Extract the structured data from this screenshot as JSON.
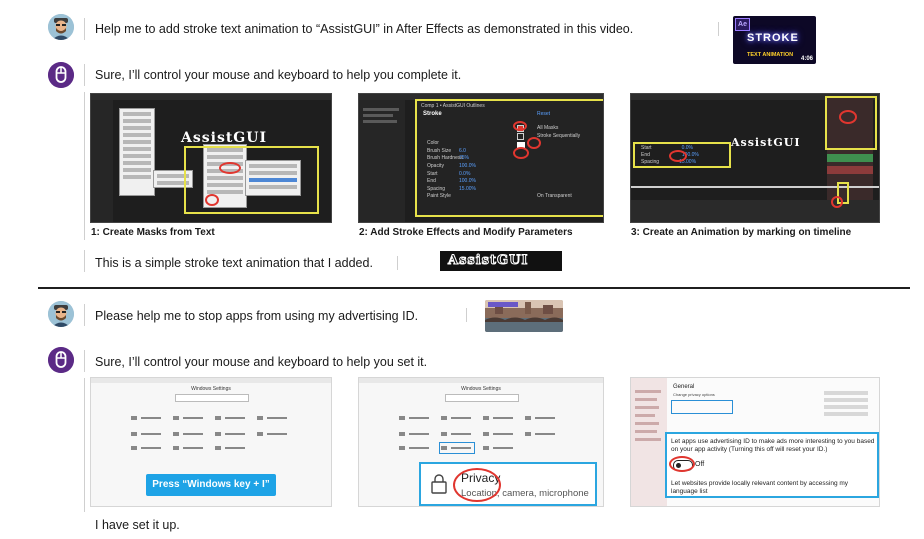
{
  "conversation1": {
    "user_message": "Help me to add stroke text animation to “AssistGUI” in After Effects as demonstrated in this video.",
    "video_thumb": {
      "badge": "Ae",
      "title": "STROKE",
      "subtitle": "TEXT ANIMATION",
      "duration": "4:06"
    },
    "bot_reply": "Sure, I’ll control your mouse and keyboard to help you complete it.",
    "steps": [
      {
        "caption": "1: Create Masks from Text",
        "shot_text": "AssistGUI"
      },
      {
        "caption": "2: Add Stroke Effects and Modify Parameters",
        "shot_text": "Comp 1 • AssistGUI Outlines",
        "panel_title": "Stroke",
        "panel_reset": "Reset",
        "rows": [
          "All Masks",
          "Stroke Sequentially",
          "Color",
          "Brush Size",
          "Brush Hardness",
          "Opacity",
          "Start",
          "End",
          "Spacing",
          "Paint Style"
        ],
        "values": [
          "",
          "",
          "",
          "6.0",
          "75%",
          "100.0%",
          "0.0%",
          "100.0%",
          "15.00%",
          "On Transparent"
        ]
      },
      {
        "caption": "3: Create an Animation by marking on timeline",
        "shot_text": "AssistGUI",
        "rows": [
          "Start",
          "End",
          "Spacing"
        ],
        "values": [
          "0.0%",
          "100.0%",
          "15.00%"
        ]
      }
    ],
    "result_text": "This is a simple stroke text animation that I added.",
    "result_image_text": "AssistGUI"
  },
  "conversation2": {
    "user_message": "Please help me to stop apps from using my advertising ID.",
    "bot_reply": "Sure, I’ll control your mouse and keyboard to help you set it.",
    "step1": {
      "window_title": "Windows Settings",
      "button": "Press “Windows key + I”"
    },
    "step2": {
      "window_title": "Windows Settings",
      "privacy_title": "Privacy",
      "privacy_sub": "Location, camera, microphone"
    },
    "step3": {
      "heading": "General",
      "sub": "Change privacy options",
      "ad_text": "Let apps use advertising ID to make ads more interesting to you based on your app activity (Turning this off will reset your ID.)",
      "toggle_label": "Off",
      "lang_text": "Let websites provide locally relevant content by accessing my language list"
    },
    "done_text": "I have set it up."
  },
  "colors": {
    "highlight": "#e6e14a",
    "circle": "#e0362f",
    "accent_blue": "#1ea3e6",
    "bot_avatar": "#5b2a86"
  }
}
